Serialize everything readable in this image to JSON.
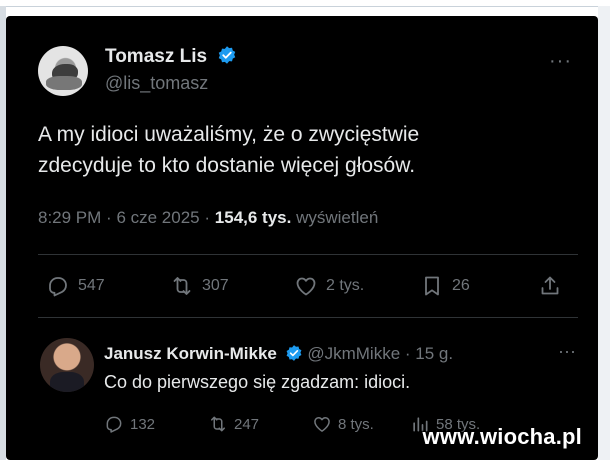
{
  "tweet": {
    "author_name": "Tomasz Lis",
    "author_handle": "@lis_tomasz",
    "more_label": "···",
    "text_line1": "A my idioci uważaliśmy, że o zwycięstwie",
    "text_line2": "zdecyduje to kto dostanie więcej głosów.",
    "time": "8:29 PM",
    "sep": "·",
    "date": "6 cze 2025",
    "views_count": "154,6 tys.",
    "views_label": "wyświetleń",
    "actions": {
      "replies": "547",
      "reposts": "307",
      "likes": "2 tys.",
      "bookmarks": "26"
    }
  },
  "reply": {
    "author_name": "Janusz Korwin-Mikke",
    "author_handle": "@JkmMikke",
    "sep": "·",
    "time": "15 g.",
    "more_label": "···",
    "text": "Co do pierwszego się zgadzam: idioci.",
    "actions": {
      "replies": "132",
      "reposts": "247",
      "likes": "8 tys.",
      "views": "58 tys."
    }
  },
  "watermark": "www.wiocha.pl",
  "colors": {
    "background": "#000000",
    "text": "#e7e9ea",
    "muted": "#71767b",
    "verified": "#1d9bf0",
    "divider": "#2f3336"
  },
  "icons": [
    "verified-badge-icon",
    "reply-icon",
    "repost-icon",
    "like-icon",
    "bookmark-icon",
    "share-icon",
    "views-icon",
    "more-icon"
  ]
}
